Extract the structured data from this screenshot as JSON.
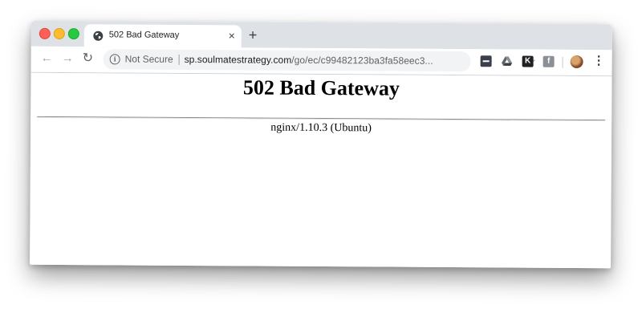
{
  "tab": {
    "title": "502 Bad Gateway",
    "close_glyph": "×",
    "favicon": "globe-icon"
  },
  "new_tab_glyph": "+",
  "toolbar": {
    "back_glyph": "←",
    "forward_glyph": "→",
    "reload_glyph": "↻",
    "security_label": "Not Secure",
    "url_host": "sp.soulmatestrategy.com",
    "url_path": "/go/ec/c99482123ba3fa58eec3...",
    "star_glyph": "☆",
    "menu_glyph": "⋮",
    "extensions": {
      "k_letter": "K",
      "f_letter": "f"
    }
  },
  "page": {
    "heading": "502 Bad Gateway",
    "server": "nginx/1.10.3 (Ubuntu)"
  },
  "colors": {
    "close": "#ff5f57",
    "minimize": "#febc2e",
    "maximize": "#28c840",
    "tab_bar": "#dee1e6",
    "omnibox": "#f1f3f4"
  }
}
